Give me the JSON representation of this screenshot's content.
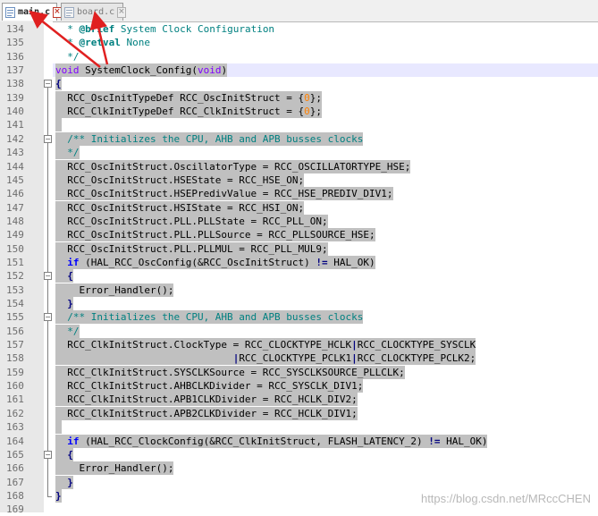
{
  "tabs": [
    {
      "label": "main.c",
      "active": true
    },
    {
      "label": "board.c",
      "active": false
    }
  ],
  "lines": [
    {
      "no": "134",
      "parts": [
        {
          "t": "  * ",
          "c": "t-comment"
        },
        {
          "t": "@brief",
          "c": "t-doctag"
        },
        {
          "t": " System Clock Configuration",
          "c": "t-comment"
        }
      ]
    },
    {
      "no": "135",
      "parts": [
        {
          "t": "  * ",
          "c": "t-comment"
        },
        {
          "t": "@retval",
          "c": "t-doctag"
        },
        {
          "t": " None",
          "c": "t-comment"
        }
      ]
    },
    {
      "no": "136",
      "parts": [
        {
          "t": "  */",
          "c": "t-comment"
        }
      ]
    },
    {
      "no": "137",
      "parts": [
        {
          "t": "void",
          "c": "t-type"
        },
        {
          "t": " SystemClock_Config(",
          "c": ""
        },
        {
          "t": "void",
          "c": "t-type"
        },
        {
          "t": ")",
          "c": ""
        }
      ]
    },
    {
      "no": "138",
      "parts": [
        {
          "t": "{",
          "c": "t-brace"
        }
      ]
    },
    {
      "no": "139",
      "parts": [
        {
          "t": "  RCC_OscInitTypeDef RCC_OscInitStruct = {",
          "c": ""
        },
        {
          "t": "0",
          "c": "t-number"
        },
        {
          "t": "};",
          "c": ""
        }
      ]
    },
    {
      "no": "140",
      "parts": [
        {
          "t": "  RCC_ClkInitTypeDef RCC_ClkInitStruct = {",
          "c": ""
        },
        {
          "t": "0",
          "c": "t-number"
        },
        {
          "t": "};",
          "c": ""
        }
      ]
    },
    {
      "no": "141",
      "parts": []
    },
    {
      "no": "142",
      "parts": [
        {
          "t": "  /** Initializes the CPU, AHB and APB busses clocks",
          "c": "t-comment"
        }
      ]
    },
    {
      "no": "143",
      "parts": [
        {
          "t": "  */",
          "c": "t-comment"
        }
      ]
    },
    {
      "no": "144",
      "parts": [
        {
          "t": "  RCC_OscInitStruct.OscillatorType = RCC_OSCILLATORTYPE_HSE;",
          "c": ""
        }
      ]
    },
    {
      "no": "145",
      "parts": [
        {
          "t": "  RCC_OscInitStruct.HSEState = RCC_HSE_ON;",
          "c": ""
        }
      ]
    },
    {
      "no": "146",
      "parts": [
        {
          "t": "  RCC_OscInitStruct.HSEPredivValue = RCC_HSE_PREDIV_DIV1;",
          "c": ""
        }
      ]
    },
    {
      "no": "147",
      "parts": [
        {
          "t": "  RCC_OscInitStruct.HSIState = RCC_HSI_ON;",
          "c": ""
        }
      ]
    },
    {
      "no": "148",
      "parts": [
        {
          "t": "  RCC_OscInitStruct.PLL.PLLState = RCC_PLL_ON;",
          "c": ""
        }
      ]
    },
    {
      "no": "149",
      "parts": [
        {
          "t": "  RCC_OscInitStruct.PLL.PLLSource = RCC_PLLSOURCE_HSE;",
          "c": ""
        }
      ]
    },
    {
      "no": "150",
      "parts": [
        {
          "t": "  RCC_OscInitStruct.PLL.PLLMUL = RCC_PLL_MUL9;",
          "c": ""
        }
      ]
    },
    {
      "no": "151",
      "parts": [
        {
          "t": "  ",
          "c": ""
        },
        {
          "t": "if",
          "c": "t-keyword"
        },
        {
          "t": " (HAL_RCC_OscConfig(&RCC_OscInitStruct) ",
          "c": ""
        },
        {
          "t": "!=",
          "c": "t-op"
        },
        {
          "t": " HAL_OK)",
          "c": ""
        }
      ]
    },
    {
      "no": "152",
      "parts": [
        {
          "t": "  {",
          "c": "t-brace"
        }
      ]
    },
    {
      "no": "153",
      "parts": [
        {
          "t": "    Error_Handler();",
          "c": ""
        }
      ]
    },
    {
      "no": "154",
      "parts": [
        {
          "t": "  }",
          "c": "t-brace"
        }
      ]
    },
    {
      "no": "155",
      "parts": [
        {
          "t": "  /** Initializes the CPU, AHB and APB busses clocks",
          "c": "t-comment"
        }
      ]
    },
    {
      "no": "156",
      "parts": [
        {
          "t": "  */",
          "c": "t-comment"
        }
      ]
    },
    {
      "no": "157",
      "parts": [
        {
          "t": "  RCC_ClkInitStruct.ClockType = RCC_CLOCKTYPE_HCLK",
          "c": ""
        },
        {
          "t": "|",
          "c": "t-op"
        },
        {
          "t": "RCC_CLOCKTYPE_SYSCLK",
          "c": ""
        }
      ]
    },
    {
      "no": "158",
      "parts": [
        {
          "t": "                              ",
          "c": ""
        },
        {
          "t": "|",
          "c": "t-op"
        },
        {
          "t": "RCC_CLOCKTYPE_PCLK1",
          "c": ""
        },
        {
          "t": "|",
          "c": "t-op"
        },
        {
          "t": "RCC_CLOCKTYPE_PCLK2;",
          "c": ""
        }
      ]
    },
    {
      "no": "159",
      "parts": [
        {
          "t": "  RCC_ClkInitStruct.SYSCLKSource = RCC_SYSCLKSOURCE_PLLCLK;",
          "c": ""
        }
      ]
    },
    {
      "no": "160",
      "parts": [
        {
          "t": "  RCC_ClkInitStruct.AHBCLKDivider = RCC_SYSCLK_DIV1;",
          "c": ""
        }
      ]
    },
    {
      "no": "161",
      "parts": [
        {
          "t": "  RCC_ClkInitStruct.APB1CLKDivider = RCC_HCLK_DIV2;",
          "c": ""
        }
      ]
    },
    {
      "no": "162",
      "parts": [
        {
          "t": "  RCC_ClkInitStruct.APB2CLKDivider = RCC_HCLK_DIV1;",
          "c": ""
        }
      ]
    },
    {
      "no": "163",
      "parts": []
    },
    {
      "no": "164",
      "parts": [
        {
          "t": "  ",
          "c": ""
        },
        {
          "t": "if",
          "c": "t-keyword"
        },
        {
          "t": " (HAL_RCC_ClockConfig(&RCC_ClkInitStruct, FLASH_LATENCY_2) ",
          "c": ""
        },
        {
          "t": "!=",
          "c": "t-op"
        },
        {
          "t": " HAL_OK)",
          "c": ""
        }
      ]
    },
    {
      "no": "165",
      "parts": [
        {
          "t": "  {",
          "c": "t-brace"
        }
      ]
    },
    {
      "no": "166",
      "parts": [
        {
          "t": "    Error_Handler();",
          "c": ""
        }
      ]
    },
    {
      "no": "167",
      "parts": [
        {
          "t": "  }",
          "c": "t-brace"
        }
      ]
    },
    {
      "no": "168",
      "parts": [
        {
          "t": "}",
          "c": "t-brace"
        }
      ]
    },
    {
      "no": "169",
      "parts": []
    }
  ],
  "watermark": "https://blog.csdn.net/MRccCHEN",
  "colors": {
    "selection": "#c0c0c0",
    "current_line": "#e8e8ff",
    "annotation_arrow": "#e02020"
  }
}
